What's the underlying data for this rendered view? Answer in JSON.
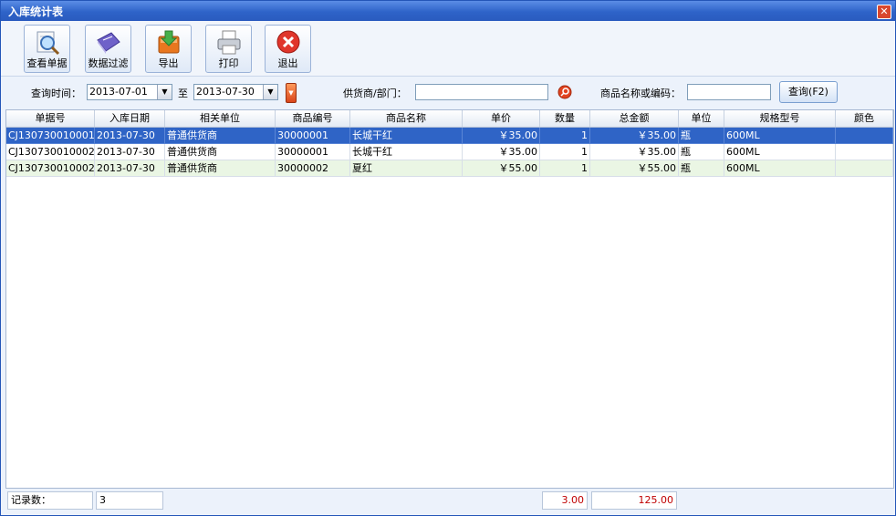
{
  "window": {
    "title": "入库统计表"
  },
  "toolbar": {
    "view": "查看单据",
    "filter": "数据过滤",
    "export": "导出",
    "print": "打印",
    "exit": "退出"
  },
  "filters": {
    "time_label": "查询时间：",
    "date_from": "2013-07-01",
    "to_label": "至",
    "date_to": "2013-07-30",
    "supplier_label": "供货商/部门：",
    "supplier_value": "",
    "product_label": "商品名称或编码：",
    "product_value": "",
    "query_button": "查询(F2)"
  },
  "table": {
    "columns": [
      "单据号",
      "入库日期",
      "相关单位",
      "商品编号",
      "商品名称",
      "单价",
      "数量",
      "总金额",
      "单位",
      "规格型号",
      "颜色"
    ],
    "rows": [
      [
        "CJ130730010001",
        "2013-07-30",
        "普通供货商",
        "30000001",
        "长城干红",
        "￥35.00",
        "1",
        "￥35.00",
        "瓶",
        "600ML",
        ""
      ],
      [
        "CJ130730010002",
        "2013-07-30",
        "普通供货商",
        "30000001",
        "长城干红",
        "￥35.00",
        "1",
        "￥35.00",
        "瓶",
        "600ML",
        ""
      ],
      [
        "CJ130730010002",
        "2013-07-30",
        "普通供货商",
        "30000002",
        "夏红",
        "￥55.00",
        "1",
        "￥55.00",
        "瓶",
        "600ML",
        ""
      ]
    ]
  },
  "status": {
    "records_label": "记录数：",
    "records_count": "3",
    "qty_total": "3.00",
    "amount_total": "125.00"
  },
  "colors": {
    "title_bar": "#2e63c8",
    "selection": "#2f64c6",
    "alt_row": "#eaf6e4",
    "total_text": "#c00000"
  }
}
